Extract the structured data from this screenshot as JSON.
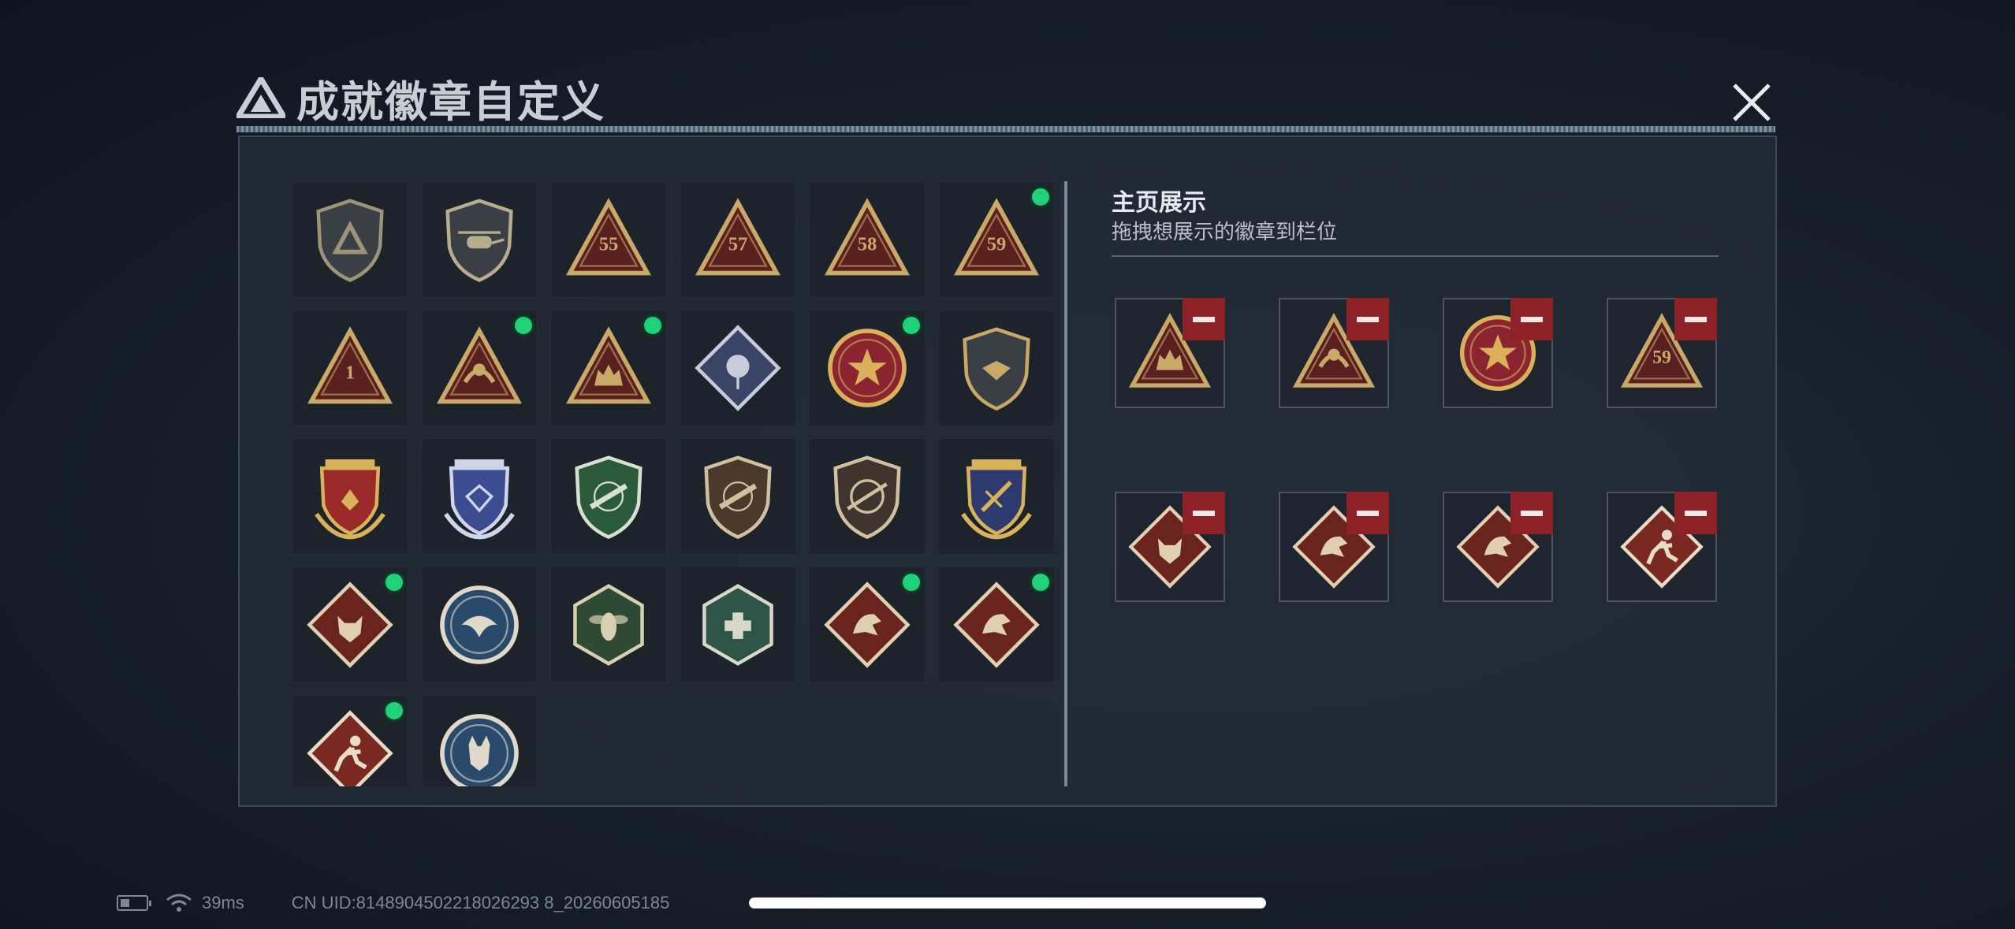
{
  "window": {
    "title": "成就徽章自定义",
    "close_icon": "close-icon"
  },
  "badges": [
    {
      "id": "badge-shield-logo",
      "shape": "shield",
      "motif": "logo",
      "fill": "#3a3f46",
      "accent": "#9c9478",
      "new": false
    },
    {
      "id": "badge-helicopter",
      "shape": "shield",
      "motif": "heli",
      "fill": "#3a3f46",
      "accent": "#b8ac8c",
      "new": false
    },
    {
      "id": "badge-tri-55",
      "shape": "triangle",
      "motif": "55",
      "fill": "#5a2020",
      "accent": "#c9a968",
      "new": false
    },
    {
      "id": "badge-tri-57",
      "shape": "triangle",
      "motif": "57",
      "fill": "#5a2020",
      "accent": "#c9a968",
      "new": false
    },
    {
      "id": "badge-tri-58",
      "shape": "triangle",
      "motif": "58",
      "fill": "#5a2020",
      "accent": "#c9a968",
      "new": false
    },
    {
      "id": "badge-tri-59",
      "shape": "triangle",
      "motif": "59",
      "fill": "#5a2020",
      "accent": "#c9a968",
      "new": true
    },
    {
      "id": "badge-tri-1",
      "shape": "triangle",
      "motif": "1",
      "fill": "#5a2020",
      "accent": "#c9a968",
      "new": false
    },
    {
      "id": "badge-tri-hands",
      "shape": "triangle",
      "motif": "hands",
      "fill": "#5a2020",
      "accent": "#c9a968",
      "new": true
    },
    {
      "id": "badge-tri-squad",
      "shape": "triangle",
      "motif": "squad",
      "fill": "#5a2020",
      "accent": "#c9a968",
      "new": true
    },
    {
      "id": "badge-diamond-rose",
      "shape": "diamond",
      "motif": "rose",
      "fill": "#3a4466",
      "accent": "#c8ccd8",
      "new": false
    },
    {
      "id": "badge-star-round",
      "shape": "round",
      "motif": "star",
      "fill": "#8a2430",
      "accent": "#d8b15a",
      "new": true
    },
    {
      "id": "badge-shield-wing",
      "shape": "shield",
      "motif": "wing",
      "fill": "#3a3f46",
      "accent": "#c9a968",
      "new": false
    },
    {
      "id": "badge-gold-crest",
      "shape": "crest",
      "motif": "stars",
      "fill": "#9a2a2a",
      "accent": "#d8b15a",
      "new": false
    },
    {
      "id": "badge-blue-crest",
      "shape": "crest",
      "motif": "gem",
      "fill": "#3c4c90",
      "accent": "#cfd6ea",
      "new": false
    },
    {
      "id": "badge-green-rifle",
      "shape": "shield",
      "motif": "rifle",
      "fill": "#2a5a3a",
      "accent": "#d8e0d0",
      "new": false
    },
    {
      "id": "badge-brown-rifle",
      "shape": "shield",
      "motif": "rifle",
      "fill": "#4a3a2c",
      "accent": "#d0c0a0",
      "new": false
    },
    {
      "id": "badge-brown-sniper",
      "shape": "shield",
      "motif": "sniper",
      "fill": "#3e362e",
      "accent": "#d0c0a0",
      "new": false
    },
    {
      "id": "badge-blue-gold-crest",
      "shape": "crest",
      "motif": "sword",
      "fill": "#2c3a70",
      "accent": "#d8b15a",
      "new": false
    },
    {
      "id": "badge-wolf",
      "shape": "diamond",
      "motif": "wolf",
      "fill": "#6a2420",
      "accent": "#e0cfb0",
      "new": true
    },
    {
      "id": "badge-eagle",
      "shape": "round",
      "motif": "eagle",
      "fill": "#2a4a6c",
      "accent": "#e0d8c8",
      "new": false
    },
    {
      "id": "badge-hornet",
      "shape": "hex",
      "motif": "hornet",
      "fill": "#2e4a34",
      "accent": "#d8d0b0",
      "new": false
    },
    {
      "id": "badge-medic",
      "shape": "hex",
      "motif": "medic",
      "fill": "#2e5448",
      "accent": "#d8d8c8",
      "new": false
    },
    {
      "id": "badge-dragon-a",
      "shape": "diamond",
      "motif": "dragon",
      "fill": "#6a2420",
      "accent": "#e0cfb0",
      "new": true
    },
    {
      "id": "badge-dragon-b",
      "shape": "diamond",
      "motif": "dragon",
      "fill": "#6a2420",
      "accent": "#e0cfb0",
      "new": true
    },
    {
      "id": "badge-runner",
      "shape": "diamond",
      "motif": "runner",
      "fill": "#7a2822",
      "accent": "#e8dcc8",
      "new": true
    },
    {
      "id": "badge-lynx",
      "shape": "round",
      "motif": "lynx",
      "fill": "#2a4a6c",
      "accent": "#e0d8c8",
      "new": false
    }
  ],
  "showcase": {
    "title": "主页展示",
    "subtitle": "拖拽想展示的徽章到栏位",
    "remove_icon": "minus-icon",
    "slots": [
      {
        "badge": "badge-tri-squad"
      },
      {
        "badge": "badge-tri-hands"
      },
      {
        "badge": "badge-star-round"
      },
      {
        "badge": "badge-tri-59"
      },
      {
        "badge": "badge-wolf"
      },
      {
        "badge": "badge-dragon-a"
      },
      {
        "badge": "badge-dragon-b"
      },
      {
        "badge": "badge-runner"
      }
    ]
  },
  "status": {
    "battery_icon": "battery-icon",
    "wifi_icon": "wifi-icon",
    "ping": "39ms",
    "uid": "CN UID:8148904502218026293 8_20260605185"
  }
}
